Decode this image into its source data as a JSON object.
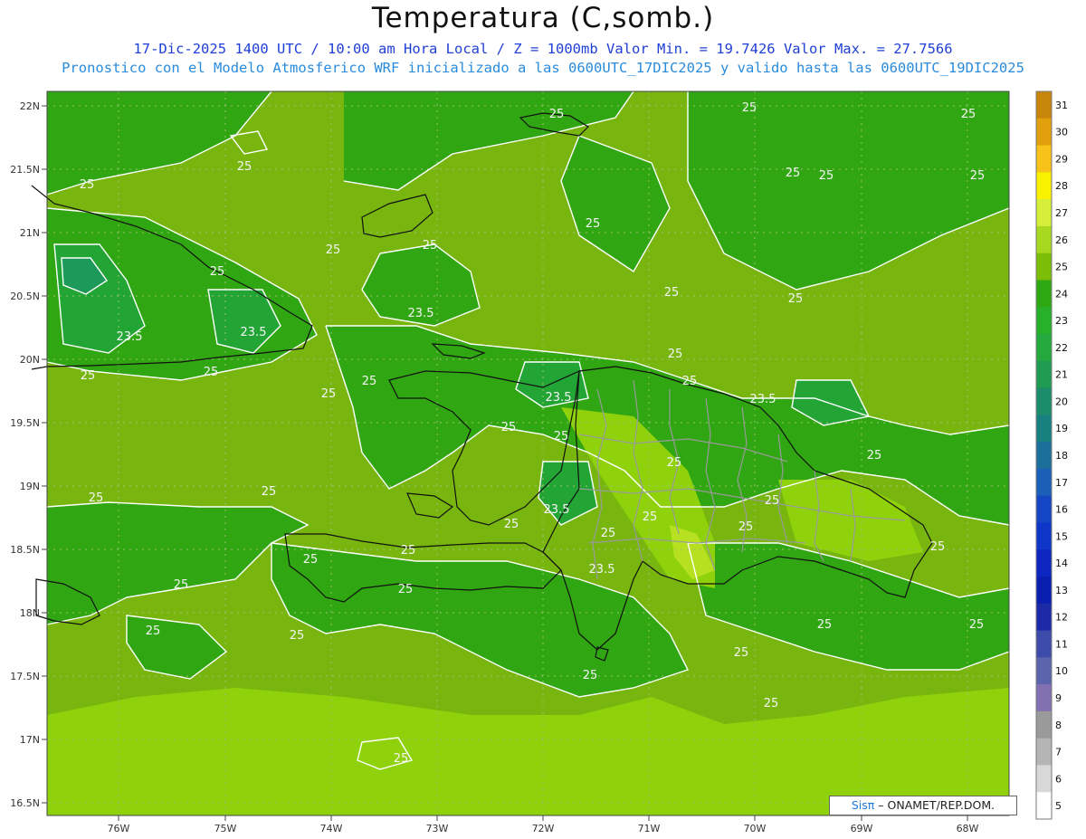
{
  "header": {
    "title": "Temperatura (C,somb.)",
    "line1": "17-Dic-2025 1400 UTC / 10:00 am Hora Local / Z = 1000mb  Valor Min. = 19.7426  Valor Max. = 27.7566",
    "line2": "Pronostico con el Modelo Atmosferico WRF inicializado a las 0600UTC_17DIC2025 y valido hasta las  0600UTC_19DIC2025"
  },
  "axes": {
    "lat_labels": [
      "22N",
      "21.5N",
      "21N",
      "20.5N",
      "20N",
      "19.5N",
      "19N",
      "18.5N",
      "18N",
      "17.5N",
      "17N",
      "16.5N"
    ],
    "lon_labels": [
      "76W",
      "75W",
      "74W",
      "73W",
      "72W",
      "71W",
      "70W",
      "69W",
      "68W"
    ]
  },
  "colorbar": {
    "labels": [
      "31",
      "30",
      "29",
      "28",
      "27",
      "26",
      "25",
      "24",
      "23",
      "22",
      "21",
      "20",
      "19",
      "18",
      "17",
      "16",
      "15",
      "14",
      "13",
      "12",
      "11",
      "10",
      "9",
      "8",
      "7",
      "6",
      "5"
    ],
    "colors": [
      "#c8860a",
      "#e2a00c",
      "#f7c21a",
      "#f8f200",
      "#d6ee3a",
      "#a8d820",
      "#7cbd0a",
      "#2da812",
      "#27b02a",
      "#25a83e",
      "#1f9c52",
      "#1c8c6a",
      "#198080",
      "#1a6f9b",
      "#1b5fb9",
      "#1446c4",
      "#0f36c9",
      "#0d26c1",
      "#0a1eb0",
      "#1d2aa8",
      "#3d4bab",
      "#5b64ad",
      "#8270b0",
      "#9a9a9a",
      "#b5b5b5",
      "#d8d8d8",
      "#ffffff"
    ]
  },
  "contour_labels": [
    "25",
    "25",
    "25",
    "25",
    "25",
    "25",
    "25",
    "25",
    "25",
    "25",
    "25",
    "25",
    "25",
    "25",
    "25",
    "25",
    "25",
    "25",
    "25",
    "25",
    "25",
    "25",
    "25",
    "25",
    "25",
    "25",
    "25",
    "25",
    "25",
    "25",
    "25",
    "25",
    "25",
    "25",
    "23.5",
    "23.5",
    "23.5",
    "23.5",
    "23.5",
    "23.5",
    "23.5"
  ],
  "credit": {
    "brand": "Sisπ",
    "org": " ONAMET/REP.DOM."
  }
}
